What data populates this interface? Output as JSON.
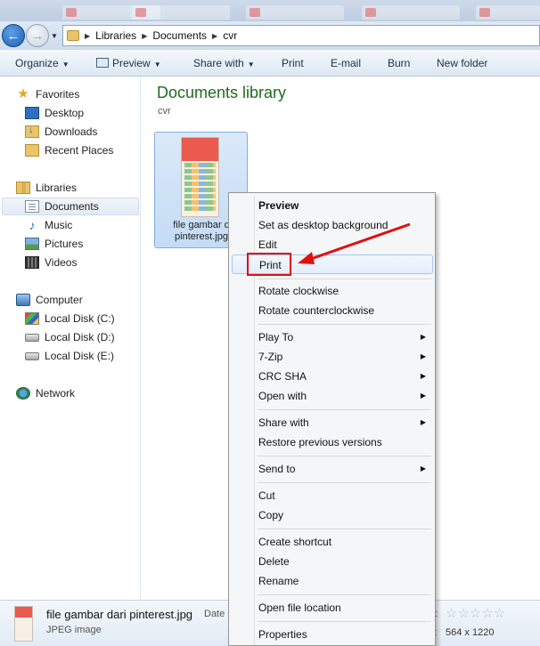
{
  "address_bar": {
    "crumbs": [
      "Libraries",
      "Documents",
      "cvr"
    ]
  },
  "command_bar": {
    "organize": "Organize",
    "preview": "Preview",
    "share_with": "Share with",
    "print": "Print",
    "email": "E-mail",
    "burn": "Burn",
    "new_folder": "New folder"
  },
  "nav_pane": {
    "favorites": "Favorites",
    "desktop": "Desktop",
    "downloads": "Downloads",
    "recent_places": "Recent Places",
    "libraries": "Libraries",
    "documents": "Documents",
    "music": "Music",
    "pictures": "Pictures",
    "videos": "Videos",
    "computer": "Computer",
    "disk_c": "Local Disk (C:)",
    "disk_d": "Local Disk (D:)",
    "disk_e": "Local Disk (E:)",
    "network": "Network"
  },
  "content": {
    "title": "Documents library",
    "subtitle": "cvr",
    "file_label_line1": "file gambar d",
    "file_label_line2": "pinterest.jpg"
  },
  "context_menu": {
    "preview": "Preview",
    "set_bg": "Set as desktop background",
    "edit": "Edit",
    "print": "Print",
    "rotate_cw": "Rotate clockwise",
    "rotate_ccw": "Rotate counterclockwise",
    "play_to": "Play To",
    "zip": "7-Zip",
    "crc": "CRC SHA",
    "open_with": "Open with",
    "share_with": "Share with",
    "restore": "Restore previous versions",
    "send_to": "Send to",
    "cut": "Cut",
    "copy": "Copy",
    "create_shortcut": "Create shortcut",
    "delete": "Delete",
    "rename": "Rename",
    "open_location": "Open file location",
    "properties": "Properties"
  },
  "details": {
    "name": "file gambar dari pinterest.jpg",
    "type": "JPEG image",
    "date_label": "Date",
    "rating_label": "g:",
    "stars": "☆☆☆☆☆",
    "dim_label": "s:",
    "dimensions": "564 x 1220"
  },
  "colors": {
    "accent_green": "#1e6b1e",
    "annotation_red": "#e01010",
    "highlight_border": "#a8c7ea"
  }
}
